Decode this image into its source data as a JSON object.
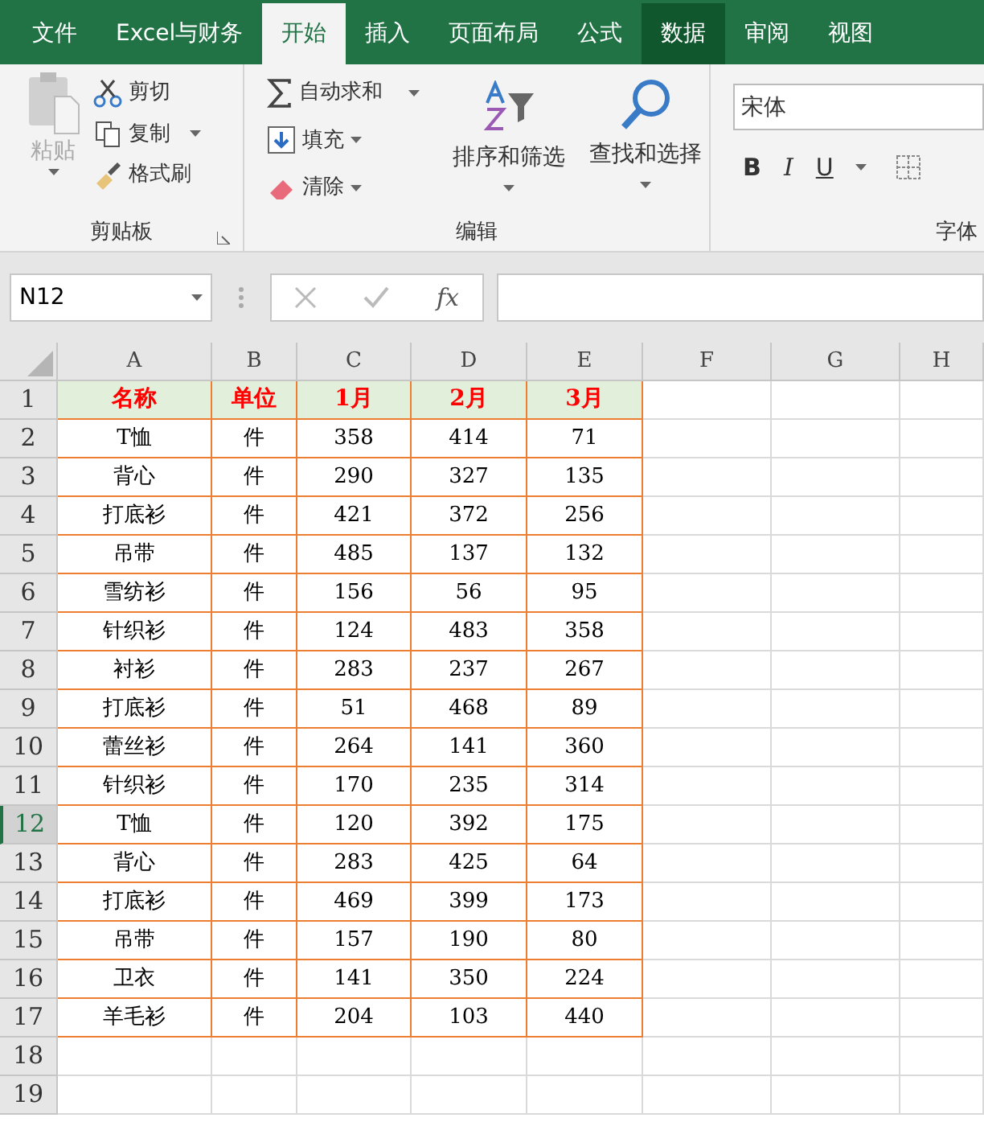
{
  "menu_tabs": [
    {
      "label": "文件",
      "selected": false,
      "hovered": false
    },
    {
      "label": "Excel与财务",
      "selected": false,
      "hovered": false
    },
    {
      "label": "开始",
      "selected": true,
      "hovered": false
    },
    {
      "label": "插入",
      "selected": false,
      "hovered": false
    },
    {
      "label": "页面布局",
      "selected": false,
      "hovered": false
    },
    {
      "label": "公式",
      "selected": false,
      "hovered": false
    },
    {
      "label": "数据",
      "selected": false,
      "hovered": true
    },
    {
      "label": "审阅",
      "selected": false,
      "hovered": false
    },
    {
      "label": "视图",
      "selected": false,
      "hovered": false
    }
  ],
  "clipboard": {
    "paste": {
      "label": "粘贴",
      "disabled": true
    },
    "cut": "剪切",
    "copy": "复制",
    "format_painter": "格式刷",
    "group_label": "剪贴板"
  },
  "editing": {
    "autosum": "自动求和",
    "fill": "填充",
    "clear": "清除",
    "sort_filter": "排序和筛选",
    "find_select": "查找和选择",
    "group_label": "编辑"
  },
  "font": {
    "font_name": "宋体",
    "bold": "B",
    "italic": "I",
    "underline": "U",
    "group_label": "字体"
  },
  "formula_bar": {
    "name_box": "N12",
    "fx": "fx"
  },
  "columns": [
    "A",
    "B",
    "C",
    "D",
    "E",
    "F",
    "G",
    "H"
  ],
  "row_headers": [
    {
      "label": "1",
      "selected": false
    },
    {
      "label": "2",
      "selected": false
    },
    {
      "label": "3",
      "selected": false
    },
    {
      "label": "4",
      "selected": false
    },
    {
      "label": "5",
      "selected": false
    },
    {
      "label": "6",
      "selected": false
    },
    {
      "label": "7",
      "selected": false
    },
    {
      "label": "8",
      "selected": false
    },
    {
      "label": "9",
      "selected": false
    },
    {
      "label": "10",
      "selected": false
    },
    {
      "label": "11",
      "selected": false
    },
    {
      "label": "12",
      "selected": true
    },
    {
      "label": "13",
      "selected": false
    },
    {
      "label": "14",
      "selected": false
    },
    {
      "label": "15",
      "selected": false
    },
    {
      "label": "16",
      "selected": false
    },
    {
      "label": "17",
      "selected": false
    },
    {
      "label": "18",
      "selected": false
    },
    {
      "label": "19",
      "selected": false
    }
  ],
  "table": {
    "header": [
      "名称",
      "单位",
      "1月",
      "2月",
      "3月"
    ],
    "rows": [
      [
        "T恤",
        "件",
        "358",
        "414",
        "71"
      ],
      [
        "背心",
        "件",
        "290",
        "327",
        "135"
      ],
      [
        "打底衫",
        "件",
        "421",
        "372",
        "256"
      ],
      [
        "吊带",
        "件",
        "485",
        "137",
        "132"
      ],
      [
        "雪纺衫",
        "件",
        "156",
        "56",
        "95"
      ],
      [
        "针织衫",
        "件",
        "124",
        "483",
        "358"
      ],
      [
        "衬衫",
        "件",
        "283",
        "237",
        "267"
      ],
      [
        "打底衫",
        "件",
        "51",
        "468",
        "89"
      ],
      [
        "蕾丝衫",
        "件",
        "264",
        "141",
        "360"
      ],
      [
        "针织衫",
        "件",
        "170",
        "235",
        "314"
      ],
      [
        "T恤",
        "件",
        "120",
        "392",
        "175"
      ],
      [
        "背心",
        "件",
        "283",
        "425",
        "64"
      ],
      [
        "打底衫",
        "件",
        "469",
        "399",
        "173"
      ],
      [
        "吊带",
        "件",
        "157",
        "190",
        "80"
      ],
      [
        "卫衣",
        "件",
        "141",
        "350",
        "224"
      ],
      [
        "羊毛衫",
        "件",
        "204",
        "103",
        "440"
      ]
    ]
  }
}
